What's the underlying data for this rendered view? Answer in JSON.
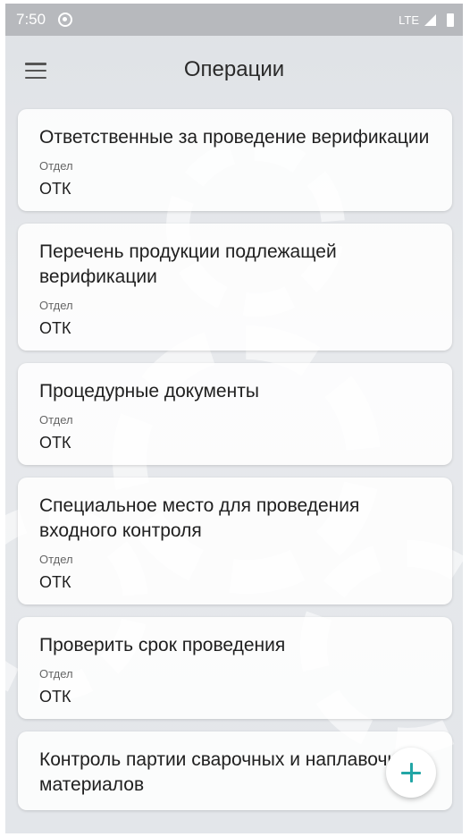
{
  "status_bar": {
    "time": "7:50",
    "network": "LTE"
  },
  "header": {
    "title": "Операции"
  },
  "operations": [
    {
      "title": "Ответственные за проведение верификации",
      "label": "Отдел",
      "value": "ОТК"
    },
    {
      "title": "Перечень продукции подлежащей верификации",
      "label": "Отдел",
      "value": "ОТК"
    },
    {
      "title": "Процедурные документы",
      "label": "Отдел",
      "value": "ОТК"
    },
    {
      "title": "Специальное место для проведения входного контроля",
      "label": "Отдел",
      "value": "ОТК"
    },
    {
      "title": "Проверить срок проведения",
      "label": "Отдел",
      "value": "ОТК"
    },
    {
      "title": "Контроль партии сварочных и наплавочных материалов",
      "label": "",
      "value": ""
    }
  ],
  "colors": {
    "fab_accent": "#22a6a6",
    "status_bar": "#b7b9bd"
  }
}
